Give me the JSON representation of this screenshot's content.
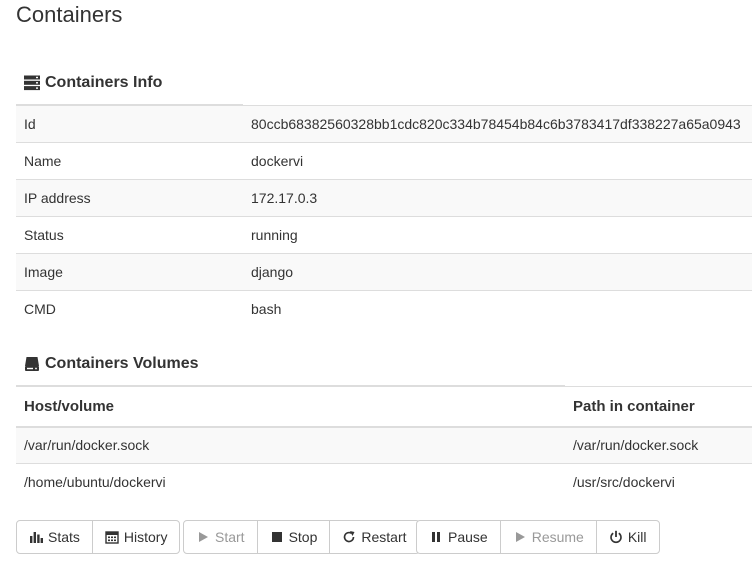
{
  "page": {
    "title": "Containers"
  },
  "info": {
    "heading": "Containers Info",
    "rows": [
      {
        "label": "Id",
        "value": "80ccb68382560328bb1cdc820c334b78454b84c6b3783417df338227a65a0943"
      },
      {
        "label": "Name",
        "value": "dockervi"
      },
      {
        "label": "IP address",
        "value": "172.17.0.3"
      },
      {
        "label": "Status",
        "value": "running"
      },
      {
        "label": "Image",
        "value": "django"
      },
      {
        "label": "CMD",
        "value": "bash"
      }
    ]
  },
  "volumes": {
    "heading": "Containers Volumes",
    "columns": [
      "Host/volume",
      "Path in container"
    ],
    "rows": [
      [
        "/var/run/docker.sock",
        "/var/run/docker.sock"
      ],
      [
        "/home/ubuntu/dockervi",
        "/usr/src/dockervi"
      ]
    ]
  },
  "actions": {
    "stats": "Stats",
    "history": "History",
    "start": "Start",
    "stop": "Stop",
    "restart": "Restart",
    "pause": "Pause",
    "resume": "Resume",
    "kill": "Kill"
  },
  "icons": {
    "info": "server-icon",
    "volumes": "hdd-icon",
    "stats": "bar-chart-icon",
    "history": "calendar-icon",
    "start": "play-icon",
    "stop": "stop-icon",
    "restart": "refresh-icon",
    "pause": "pause-icon",
    "resume": "play-icon",
    "kill": "power-icon"
  },
  "colors": {
    "text": "#333333",
    "disabled": "#999999",
    "border": "#dddddd",
    "stripe": "#f9f9f9"
  }
}
